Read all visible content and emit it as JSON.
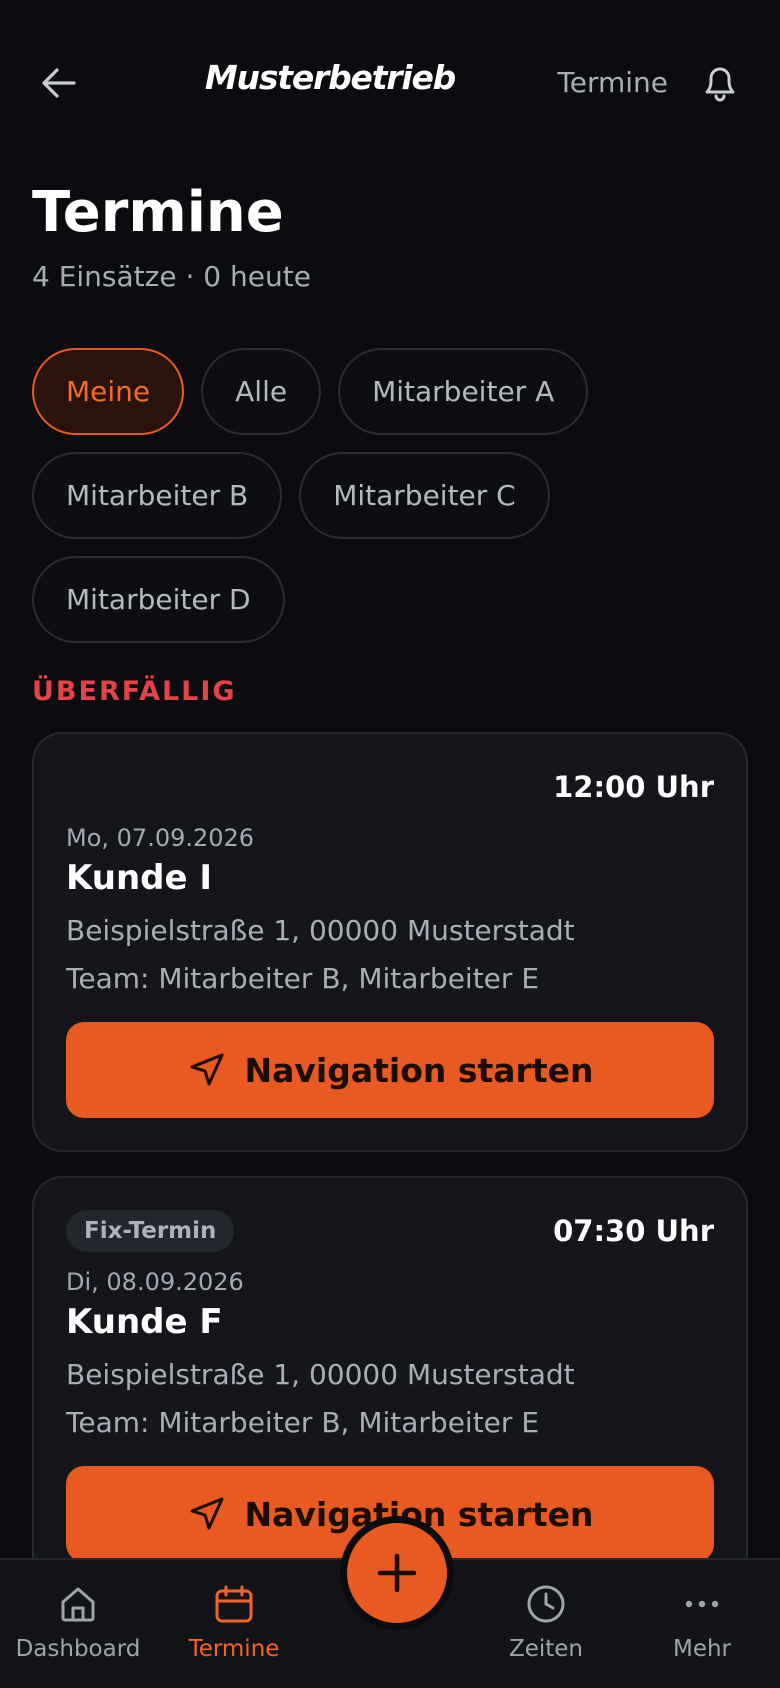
{
  "header": {
    "brand": "Musterbetrieb",
    "link": "Termine"
  },
  "page": {
    "title": "Termine",
    "subtitle": "4 Einsätze · 0 heute"
  },
  "filters": [
    {
      "label": "Meine",
      "active": true
    },
    {
      "label": "Alle"
    },
    {
      "label": "Mitarbeiter A"
    },
    {
      "label": "Mitarbeiter B"
    },
    {
      "label": "Mitarbeiter C"
    },
    {
      "label": "Mitarbeiter D"
    }
  ],
  "section": {
    "overdue_label": "ÜBERFÄLLIG"
  },
  "appointments": [
    {
      "badge": "",
      "time": "12:00 Uhr",
      "date": "Mo, 07.09.2026",
      "customer": "Kunde I",
      "address": "Beispielstraße 1, 00000 Musterstadt",
      "team": "Team: Mitarbeiter B, Mitarbeiter E",
      "action": "Navigation starten"
    },
    {
      "badge": "Fix-Termin",
      "time": "07:30 Uhr",
      "date": "Di, 08.09.2026",
      "customer": "Kunde F",
      "address": "Beispielstraße 1, 00000 Musterstadt",
      "team": "Team: Mitarbeiter B, Mitarbeiter E",
      "action": "Navigation starten"
    }
  ],
  "bottom_nav": [
    {
      "label": "Dashboard",
      "icon": "home-icon"
    },
    {
      "label": "Termine",
      "icon": "calendar-icon",
      "active": true
    },
    {
      "label": "Zeiten",
      "icon": "clock-icon"
    },
    {
      "label": "Mehr",
      "icon": "more-icon"
    }
  ],
  "colors": {
    "background": "#0b0c0f",
    "accent": "#e85a22",
    "overdue": "#e4434a",
    "card": "#14161b"
  }
}
